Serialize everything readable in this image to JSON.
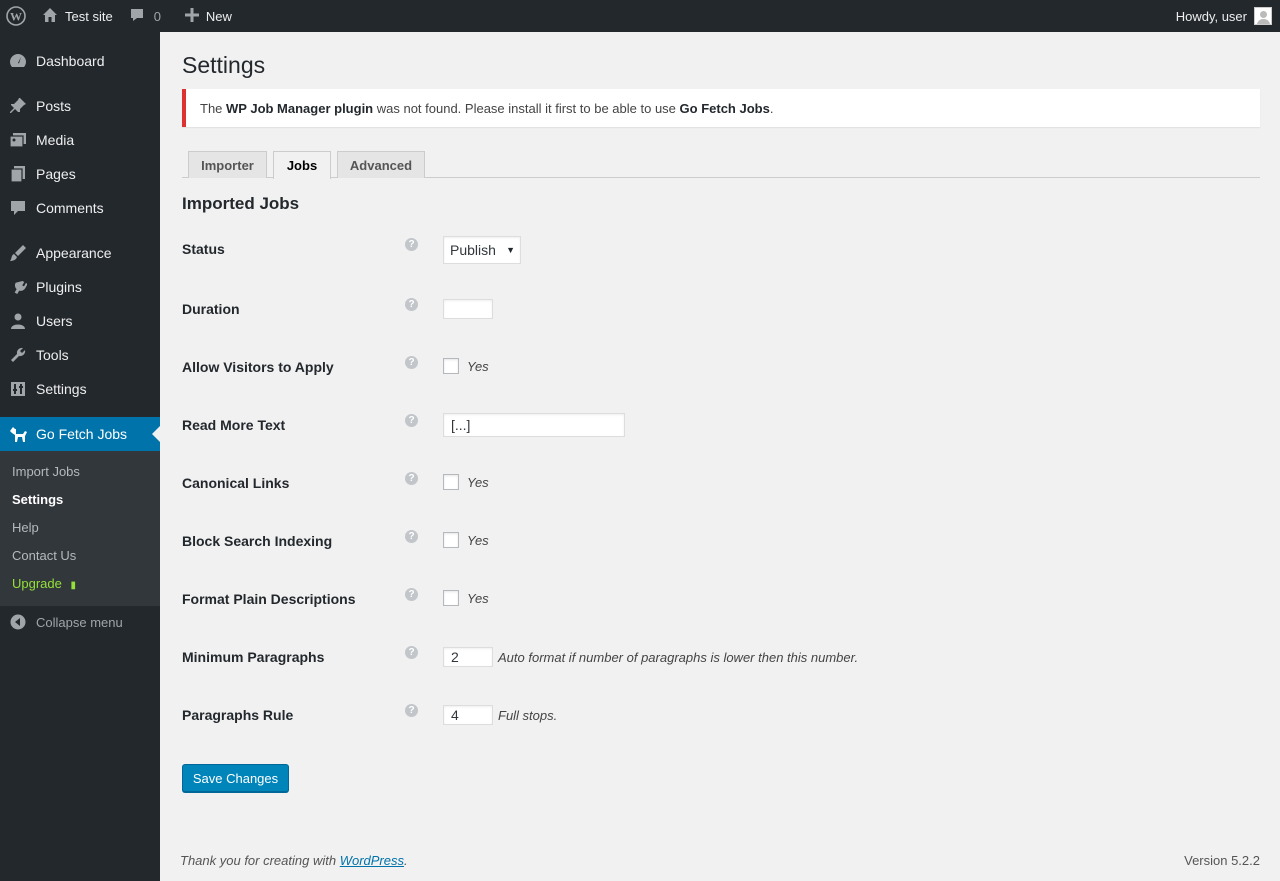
{
  "adminbar": {
    "site_name": "Test site",
    "comment_count": "0",
    "new_label": "New",
    "howdy": "Howdy, user"
  },
  "menu": {
    "items": [
      {
        "label": "Dashboard",
        "icon": "dashboard-icon"
      },
      {
        "label": "Posts",
        "icon": "pin-icon"
      },
      {
        "label": "Media",
        "icon": "media-icon"
      },
      {
        "label": "Pages",
        "icon": "pages-icon"
      },
      {
        "label": "Comments",
        "icon": "comment-icon"
      },
      {
        "label": "Appearance",
        "icon": "brush-icon"
      },
      {
        "label": "Plugins",
        "icon": "plug-icon"
      },
      {
        "label": "Users",
        "icon": "user-icon"
      },
      {
        "label": "Tools",
        "icon": "wrench-icon"
      },
      {
        "label": "Settings",
        "icon": "settings-icon"
      },
      {
        "label": "Go Fetch Jobs",
        "icon": "dog-icon"
      }
    ],
    "submenu": [
      "Import Jobs",
      "Settings",
      "Help",
      "Contact Us",
      "Upgrade"
    ],
    "collapse": "Collapse menu"
  },
  "page": {
    "title": "Settings",
    "notice": {
      "pre": "The ",
      "plugin": "WP Job Manager plugin",
      "mid": " was not found. Please install it first to be able to use ",
      "product": "Go Fetch Jobs",
      "post": "."
    },
    "tabs": [
      "Importer",
      "Jobs",
      "Advanced"
    ],
    "active_tab": "Jobs",
    "section_title": "Imported Jobs",
    "fields": {
      "status": {
        "label": "Status",
        "value": "Publish"
      },
      "duration": {
        "label": "Duration",
        "value": ""
      },
      "allow_apply": {
        "label": "Allow Visitors to Apply",
        "option": "Yes"
      },
      "read_more": {
        "label": "Read More Text",
        "value": "[...]"
      },
      "canonical": {
        "label": "Canonical Links",
        "option": "Yes"
      },
      "block_index": {
        "label": "Block Search Indexing",
        "option": "Yes"
      },
      "format_plain": {
        "label": "Format Plain Descriptions",
        "option": "Yes"
      },
      "min_paragraphs": {
        "label": "Minimum Paragraphs",
        "value": "2",
        "description": "Auto format if number of paragraphs is lower then this number."
      },
      "paragraphs_rule": {
        "label": "Paragraphs Rule",
        "value": "4",
        "description": "Full stops."
      }
    },
    "save_label": "Save Changes"
  },
  "footer": {
    "thanks_pre": "Thank you for creating with ",
    "thanks_link": "WordPress",
    "thanks_post": ".",
    "version": "Version 5.2.2"
  },
  "colors": {
    "accent": "#0073aa",
    "error": "#dc3232",
    "upgrade": "#93e037"
  }
}
